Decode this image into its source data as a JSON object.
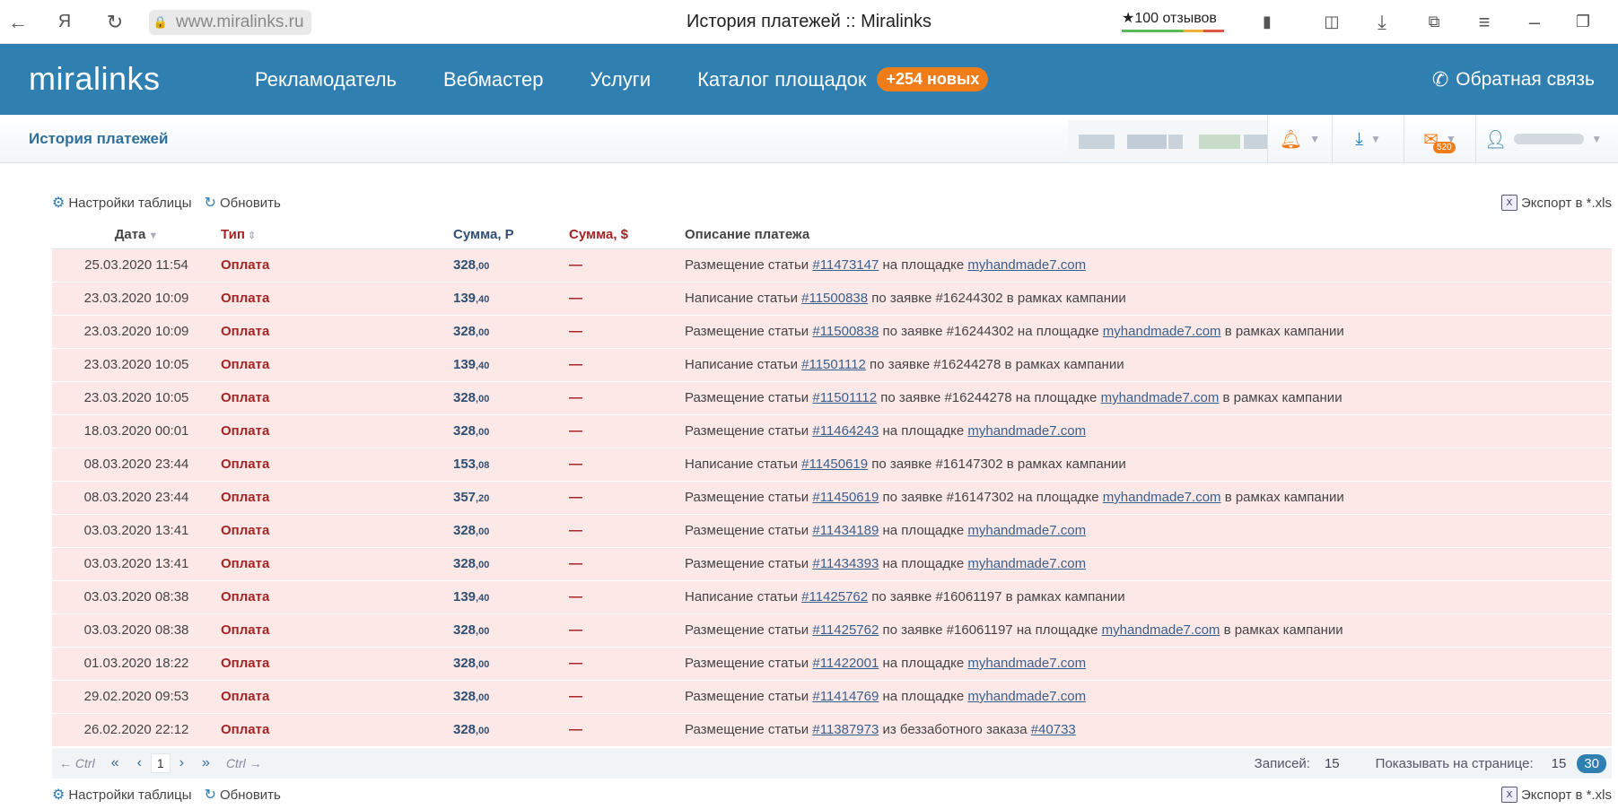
{
  "browser": {
    "url": "www.miralinks.ru",
    "title": "История платежей :: Miralinks",
    "reviews": "★100 отзывов"
  },
  "header": {
    "logo": "miralinks",
    "nav": [
      "Рекламодатель",
      "Вебмастер",
      "Услуги",
      "Каталог площадок"
    ],
    "new_badge": "+254 новых",
    "feedback": "Обратная связь",
    "accent": "#2f7fb1",
    "badge_color": "#f07d1a"
  },
  "subheader": {
    "title": "История платежей",
    "mail_count": "520"
  },
  "toolbar": {
    "settings": "Настройки таблицы",
    "refresh": "Обновить",
    "export": "Экспорт в *.xls"
  },
  "table": {
    "headers": [
      "Дата",
      "Тип",
      "Сумма, Р",
      "Сумма, $",
      "Описание платежа"
    ],
    "rows": [
      {
        "date": "25.03.2020 11:54",
        "type": "Оплата",
        "rub": "328",
        "kop": ",00",
        "usd": "—",
        "d1": "Размещение статьи ",
        "l1": "#11473147",
        "d2": " на площадке ",
        "l2": "myhandmade7.com",
        "d3": ""
      },
      {
        "date": "23.03.2020 10:09",
        "type": "Оплата",
        "rub": "139",
        "kop": ",40",
        "usd": "—",
        "d1": "Написание статьи ",
        "l1": "#11500838",
        "d2": " по заявке #16244302 в рамках кампании",
        "l2": "",
        "d3": ""
      },
      {
        "date": "23.03.2020 10:09",
        "type": "Оплата",
        "rub": "328",
        "kop": ",00",
        "usd": "—",
        "d1": "Размещение статьи ",
        "l1": "#11500838",
        "d2": " по заявке #16244302 на площадке ",
        "l2": "myhandmade7.com",
        "d3": " в рамках кампании"
      },
      {
        "date": "23.03.2020 10:05",
        "type": "Оплата",
        "rub": "139",
        "kop": ",40",
        "usd": "—",
        "d1": "Написание статьи ",
        "l1": "#11501112",
        "d2": " по заявке #16244278 в рамках кампании",
        "l2": "",
        "d3": ""
      },
      {
        "date": "23.03.2020 10:05",
        "type": "Оплата",
        "rub": "328",
        "kop": ",00",
        "usd": "—",
        "d1": "Размещение статьи ",
        "l1": "#11501112",
        "d2": " по заявке #16244278 на площадке ",
        "l2": "myhandmade7.com",
        "d3": " в рамках кампании"
      },
      {
        "date": "18.03.2020 00:01",
        "type": "Оплата",
        "rub": "328",
        "kop": ",00",
        "usd": "—",
        "d1": "Размещение статьи ",
        "l1": "#11464243",
        "d2": " на площадке ",
        "l2": "myhandmade7.com",
        "d3": ""
      },
      {
        "date": "08.03.2020 23:44",
        "type": "Оплата",
        "rub": "153",
        "kop": ",08",
        "usd": "—",
        "d1": "Написание статьи ",
        "l1": "#11450619",
        "d2": " по заявке #16147302 в рамках кампании",
        "l2": "",
        "d3": ""
      },
      {
        "date": "08.03.2020 23:44",
        "type": "Оплата",
        "rub": "357",
        "kop": ",20",
        "usd": "—",
        "d1": "Размещение статьи ",
        "l1": "#11450619",
        "d2": " по заявке #16147302 на площадке ",
        "l2": "myhandmade7.com",
        "d3": " в рамках кампании"
      },
      {
        "date": "03.03.2020 13:41",
        "type": "Оплата",
        "rub": "328",
        "kop": ",00",
        "usd": "—",
        "d1": "Размещение статьи ",
        "l1": "#11434189",
        "d2": " на площадке ",
        "l2": "myhandmade7.com",
        "d3": ""
      },
      {
        "date": "03.03.2020 13:41",
        "type": "Оплата",
        "rub": "328",
        "kop": ",00",
        "usd": "—",
        "d1": "Размещение статьи ",
        "l1": "#11434393",
        "d2": " на площадке ",
        "l2": "myhandmade7.com",
        "d3": ""
      },
      {
        "date": "03.03.2020 08:38",
        "type": "Оплата",
        "rub": "139",
        "kop": ",40",
        "usd": "—",
        "d1": "Написание статьи ",
        "l1": "#11425762",
        "d2": " по заявке #16061197 в рамках кампании",
        "l2": "",
        "d3": ""
      },
      {
        "date": "03.03.2020 08:38",
        "type": "Оплата",
        "rub": "328",
        "kop": ",00",
        "usd": "—",
        "d1": "Размещение статьи ",
        "l1": "#11425762",
        "d2": " по заявке #16061197 на площадке ",
        "l2": "myhandmade7.com",
        "d3": " в рамках кампании"
      },
      {
        "date": "01.03.2020 18:22",
        "type": "Оплата",
        "rub": "328",
        "kop": ",00",
        "usd": "—",
        "d1": "Размещение статьи ",
        "l1": "#11422001",
        "d2": " на площадке ",
        "l2": "myhandmade7.com",
        "d3": ""
      },
      {
        "date": "29.02.2020 09:53",
        "type": "Оплата",
        "rub": "328",
        "kop": ",00",
        "usd": "—",
        "d1": "Размещение статьи ",
        "l1": "#11414769",
        "d2": " на площадке ",
        "l2": "myhandmade7.com",
        "d3": ""
      },
      {
        "date": "26.02.2020 22:12",
        "type": "Оплата",
        "rub": "328",
        "kop": ",00",
        "usd": "—",
        "d1": "Размещение статьи ",
        "l1": "#11387973",
        "d2": " из беззаботного заказа ",
        "l2": "#40733",
        "d3": ""
      }
    ]
  },
  "pager": {
    "prev_ctrl": "← Ctrl",
    "next_ctrl": "Ctrl →",
    "first": "«",
    "prev": "‹",
    "page": "1",
    "next": "›",
    "last": "»",
    "records_label": "Записей:",
    "records_value": "15",
    "per_page_label": "Показывать на странице:",
    "per_page_value": "15",
    "per_page_alt": "30"
  }
}
